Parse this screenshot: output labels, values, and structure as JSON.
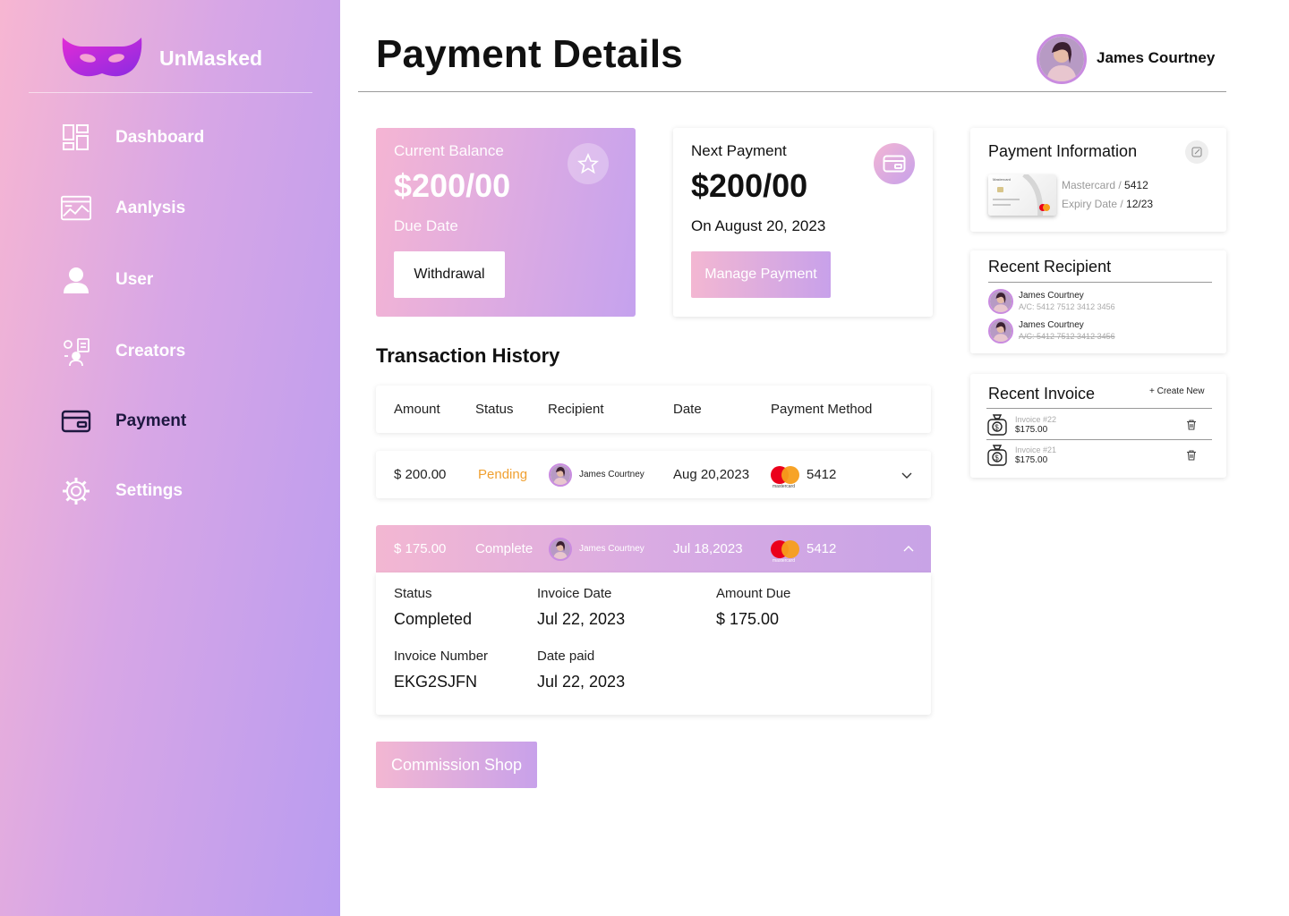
{
  "brand": {
    "name": "UnMasked"
  },
  "sidebar": {
    "items": [
      {
        "label": "Dashboard",
        "icon": "dashboard-grid-icon"
      },
      {
        "label": "Aanlysis",
        "icon": "analysis-chart-icon"
      },
      {
        "label": "User",
        "icon": "user-icon"
      },
      {
        "label": "Creators",
        "icon": "creators-icon"
      },
      {
        "label": "Payment",
        "icon": "credit-card-icon",
        "active": true
      },
      {
        "label": "Settings",
        "icon": "gear-icon"
      }
    ]
  },
  "header": {
    "title": "Payment Details",
    "user_name": "James Courtney"
  },
  "balance": {
    "label": "Current Balance",
    "amount": "$200/00",
    "due_label": "Due Date",
    "withdraw_label": "Withdrawal"
  },
  "next_payment": {
    "label": "Next Payment",
    "amount": "$200/00",
    "date": "On August 20, 2023",
    "button_label": "Manage Payment"
  },
  "transactions": {
    "title": "Transaction History",
    "columns": [
      "Amount",
      "Status",
      "Recipient",
      "Date",
      "Payment Method"
    ],
    "rows": [
      {
        "amount": "$ 200.00",
        "status": "Pending",
        "recipient": "James Courtney",
        "date": "Aug 20,2023",
        "card": "5412",
        "card_brand": "mastercard"
      },
      {
        "amount": "$ 175.00",
        "status": "Complete",
        "recipient": "James Courtney",
        "date": "Jul 18,2023",
        "card": "5412",
        "card_brand": "mastercard"
      }
    ],
    "detail": {
      "status_label": "Status",
      "status_value": "Completed",
      "invoice_date_label": "Invoice Date",
      "invoice_date_value": "Jul 22, 2023",
      "amount_due_label": "Amount Due",
      "amount_due_value": "$ 175.00",
      "invoice_number_label": "Invoice Number",
      "invoice_number_value": "EKG2SJFN",
      "date_paid_label": "Date paid",
      "date_paid_value": "Jul 22, 2023"
    }
  },
  "commission": {
    "label": "Commission Shop"
  },
  "payment_info": {
    "title": "Payment Information",
    "card_brand_label": "Mastercard",
    "card_number": "5412",
    "expiry_label": "Expiry Date",
    "expiry_value": "12/23",
    "card_image_brand": "Mastercard"
  },
  "recent_recipient": {
    "title": "Recent Recipient",
    "items": [
      {
        "name": "James Courtney",
        "account": "A/C: 5412 7512 3412 3456"
      },
      {
        "name": "James Courtney",
        "account": "A/C: 5412 7512 3412 3456"
      }
    ]
  },
  "recent_invoice": {
    "title": "Recent Invoice",
    "create_label": "+  Create New",
    "items": [
      {
        "label": "Invoice #22",
        "amount": "$175.00"
      },
      {
        "label": "Invoice #21",
        "amount": "$175.00"
      }
    ]
  },
  "colors": {
    "sidebar_gradient_start": "#f7b6d2",
    "sidebar_gradient_end": "#b99cf0",
    "pending": "#f0a030",
    "active_nav": "#1e1840"
  }
}
